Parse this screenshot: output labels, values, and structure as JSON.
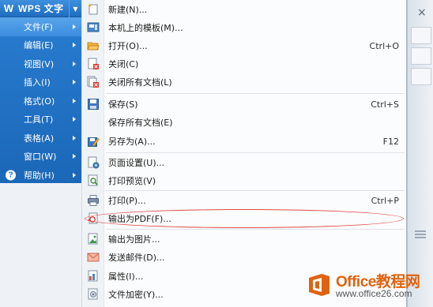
{
  "app": {
    "title": "WPS 文字",
    "logo_letter": "W"
  },
  "main_menu": {
    "items": [
      {
        "label": "文件(F)",
        "active": true,
        "has_submenu": true
      },
      {
        "label": "编辑(E)",
        "active": false,
        "has_submenu": true
      },
      {
        "label": "视图(V)",
        "active": false,
        "has_submenu": true
      },
      {
        "label": "插入(I)",
        "active": false,
        "has_submenu": true
      },
      {
        "label": "格式(O)",
        "active": false,
        "has_submenu": true
      },
      {
        "label": "工具(T)",
        "active": false,
        "has_submenu": true
      },
      {
        "label": "表格(A)",
        "active": false,
        "has_submenu": true
      },
      {
        "label": "窗口(W)",
        "active": false,
        "has_submenu": true
      },
      {
        "label": "帮助(H)",
        "active": false,
        "has_submenu": true,
        "icon": "help-icon"
      }
    ]
  },
  "file_menu": {
    "items": [
      {
        "label": "新建(N)...",
        "shortcut": "",
        "icon": "new-document-icon"
      },
      {
        "label": "本机上的模板(M)...",
        "shortcut": "",
        "icon": "template-icon"
      },
      {
        "label": "打开(O)...",
        "shortcut": "Ctrl+O",
        "icon": "open-folder-icon"
      },
      {
        "label": "关闭(C)",
        "shortcut": "",
        "icon": "close-document-icon"
      },
      {
        "label": "关闭所有文档(L)",
        "shortcut": "",
        "icon": "close-all-documents-icon"
      },
      {
        "label": "保存(S)",
        "shortcut": "Ctrl+S",
        "icon": "save-icon"
      },
      {
        "label": "保存所有文档(E)",
        "shortcut": "",
        "icon": ""
      },
      {
        "label": "另存为(A)...",
        "shortcut": "F12",
        "icon": "save-as-icon"
      },
      {
        "label": "页面设置(U)...",
        "shortcut": "",
        "icon": "page-setup-icon"
      },
      {
        "label": "打印预览(V)",
        "shortcut": "",
        "icon": "print-preview-icon"
      },
      {
        "label": "打印(P)...",
        "shortcut": "Ctrl+P",
        "icon": "printer-icon"
      },
      {
        "label": "输出为PDF(F)...",
        "shortcut": "",
        "icon": "export-pdf-icon",
        "highlighted": true
      },
      {
        "label": "输出为图片...",
        "shortcut": "",
        "icon": "export-image-icon"
      },
      {
        "label": "发送邮件(D)...",
        "shortcut": "",
        "icon": "email-icon"
      },
      {
        "label": "属性(I)...",
        "shortcut": "",
        "icon": "properties-icon"
      },
      {
        "label": "文件加密(Y)...",
        "shortcut": "",
        "icon": "encrypt-icon"
      }
    ]
  },
  "watermark": {
    "name": "Office教程网",
    "url": "www.office26.com",
    "accent_color": "#e0620f"
  },
  "colors": {
    "menu_blue": "#1f6dbf",
    "active_item": "#4a98e4",
    "annotation_red": "#e04848"
  }
}
